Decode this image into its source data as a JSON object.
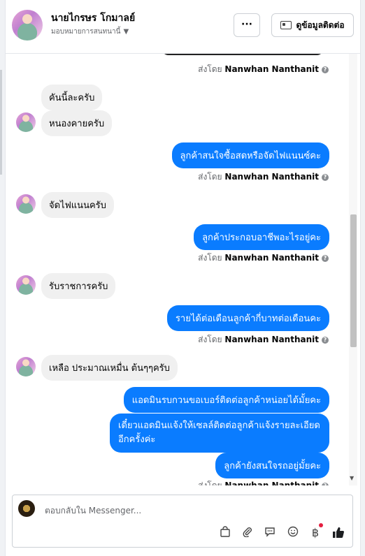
{
  "header": {
    "name": "นายไกรษร โกมาลย์",
    "assignment": "มอบหมายการสนทนานี้",
    "more_label": "···",
    "contact_label": "ดูข้อมูลติดต่อ"
  },
  "sent_by": {
    "prefix": "ส่งโดย",
    "agent": "Nanwhan Nanthanit"
  },
  "messages": [
    {
      "dir": "in",
      "text": "คันนี้ละครับ"
    },
    {
      "dir": "in",
      "text": "หนองคายครับ"
    },
    {
      "dir": "out",
      "text": "ลูกค้าสนใจซื้อสดหรือจัดไฟแนนซ์คะ"
    },
    {
      "dir": "in",
      "text": "จัดไฟแนนครับ"
    },
    {
      "dir": "out",
      "text": "ลูกค้าประกอบอาชีพอะไรอยู่คะ"
    },
    {
      "dir": "in",
      "text": "รับราชการครับ"
    },
    {
      "dir": "out",
      "text": "รายได้ต่อเดือนลูกค้ากี่บาทต่อเดือนคะ"
    },
    {
      "dir": "in",
      "text": "เหลือ ประมาณเหมื่น ต้นๆๆครับ"
    },
    {
      "dir": "out",
      "text": "แอดมินรบกวนขอเบอร์ติดต่อลูกค้าหน่อยได้มั้ยคะ"
    },
    {
      "dir": "out",
      "text": "เดี๋ยวแอดมินแจ้งให้เซลล์ติดต่อลูกค้าแจ้งรายละเอียดอีกครั้งค่ะ"
    },
    {
      "dir": "out",
      "text": "ลูกค้ายังสนใจรถอยู่มั้ยคะ"
    }
  ],
  "composer": {
    "placeholder": "ตอบกลับใน Messenger..."
  },
  "icons": {
    "bag": "shopping-bag-icon",
    "attach": "paperclip-icon",
    "saved_reply": "chat-bubble-icon",
    "emoji": "smiley-icon",
    "payment": "baht-icon",
    "like": "thumbs-up-icon"
  },
  "colors": {
    "outgoing_bubble": "#0a7cff",
    "incoming_bubble": "#f0f0f0",
    "notification_dot": "#e41e3f"
  }
}
